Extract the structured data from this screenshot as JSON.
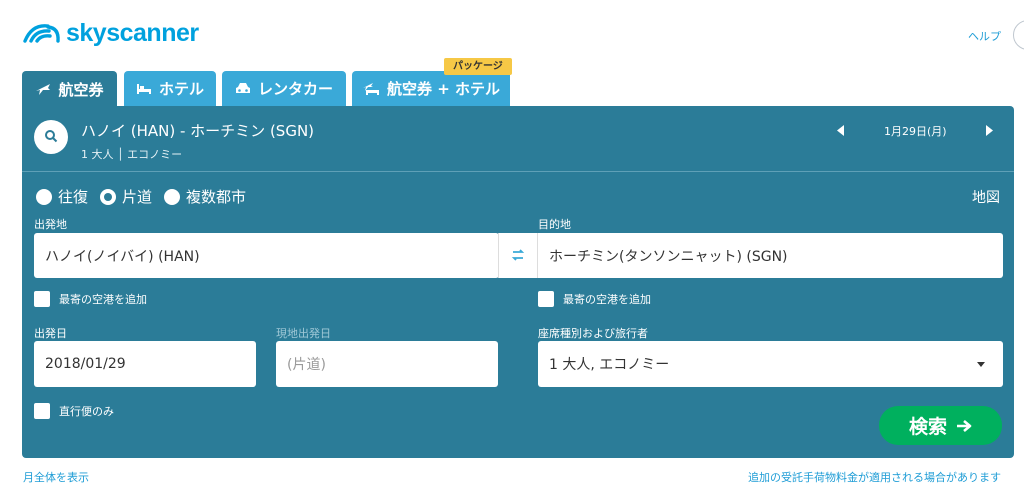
{
  "header": {
    "logo_text": "skyscanner",
    "help_label": "ヘルプ"
  },
  "tabs": [
    {
      "label": "航空券",
      "icon": "plane-icon",
      "active": true
    },
    {
      "label": "ホテル",
      "icon": "bed-icon",
      "active": false
    },
    {
      "label": "レンタカー",
      "icon": "car-icon",
      "active": false
    },
    {
      "label": "航空券 + ホテル",
      "icon": "plane-bed-icon",
      "active": false
    }
  ],
  "package_badge": "パッケージ",
  "summary": {
    "route": "ハノイ (HAN) - ホーチミン (SGN)",
    "passengers": "1 大人 │ エコノミー",
    "date": "1月29日(月)"
  },
  "trip_types": [
    {
      "label": "往復",
      "checked": false
    },
    {
      "label": "片道",
      "checked": true
    },
    {
      "label": "複数都市",
      "checked": false
    }
  ],
  "map_link": "地図",
  "origin": {
    "label": "出発地",
    "value": "ハノイ(ノイバイ) (HAN)",
    "nearby_label": "最寄の空港を追加"
  },
  "destination": {
    "label": "目的地",
    "value": "ホーチミン(タンソンニャット) (SGN)",
    "nearby_label": "最寄の空港を追加"
  },
  "depart": {
    "label": "出発日",
    "value": "2018/01/29"
  },
  "return": {
    "label": "現地出発日",
    "placeholder": "(片道)"
  },
  "cabin": {
    "label": "座席種別および旅行者",
    "value": "1 大人, エコノミー"
  },
  "direct_only_label": "直行便のみ",
  "search_label": "検索",
  "footer": {
    "left": "月全体を表示",
    "right": "追加の受託手荷物料金が適用される場合があります"
  },
  "colors": {
    "panel": "#2b7c98",
    "tab_inactive": "#3aa9d8",
    "search_button": "#00b05e",
    "badge": "#f6c846",
    "brand": "#00a1de"
  }
}
